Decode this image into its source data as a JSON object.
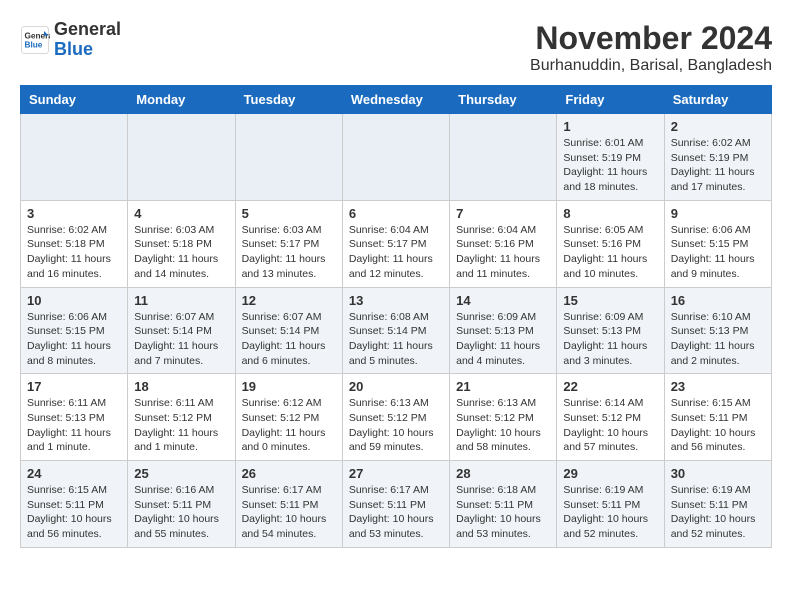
{
  "logo": {
    "line1": "General",
    "line2": "Blue"
  },
  "title": "November 2024",
  "subtitle": "Burhanuddin, Barisal, Bangladesh",
  "days_of_week": [
    "Sunday",
    "Monday",
    "Tuesday",
    "Wednesday",
    "Thursday",
    "Friday",
    "Saturday"
  ],
  "weeks": [
    [
      {
        "day": "",
        "info": ""
      },
      {
        "day": "",
        "info": ""
      },
      {
        "day": "",
        "info": ""
      },
      {
        "day": "",
        "info": ""
      },
      {
        "day": "",
        "info": ""
      },
      {
        "day": "1",
        "info": "Sunrise: 6:01 AM\nSunset: 5:19 PM\nDaylight: 11 hours and 18 minutes."
      },
      {
        "day": "2",
        "info": "Sunrise: 6:02 AM\nSunset: 5:19 PM\nDaylight: 11 hours and 17 minutes."
      }
    ],
    [
      {
        "day": "3",
        "info": "Sunrise: 6:02 AM\nSunset: 5:18 PM\nDaylight: 11 hours and 16 minutes."
      },
      {
        "day": "4",
        "info": "Sunrise: 6:03 AM\nSunset: 5:18 PM\nDaylight: 11 hours and 14 minutes."
      },
      {
        "day": "5",
        "info": "Sunrise: 6:03 AM\nSunset: 5:17 PM\nDaylight: 11 hours and 13 minutes."
      },
      {
        "day": "6",
        "info": "Sunrise: 6:04 AM\nSunset: 5:17 PM\nDaylight: 11 hours and 12 minutes."
      },
      {
        "day": "7",
        "info": "Sunrise: 6:04 AM\nSunset: 5:16 PM\nDaylight: 11 hours and 11 minutes."
      },
      {
        "day": "8",
        "info": "Sunrise: 6:05 AM\nSunset: 5:16 PM\nDaylight: 11 hours and 10 minutes."
      },
      {
        "day": "9",
        "info": "Sunrise: 6:06 AM\nSunset: 5:15 PM\nDaylight: 11 hours and 9 minutes."
      }
    ],
    [
      {
        "day": "10",
        "info": "Sunrise: 6:06 AM\nSunset: 5:15 PM\nDaylight: 11 hours and 8 minutes."
      },
      {
        "day": "11",
        "info": "Sunrise: 6:07 AM\nSunset: 5:14 PM\nDaylight: 11 hours and 7 minutes."
      },
      {
        "day": "12",
        "info": "Sunrise: 6:07 AM\nSunset: 5:14 PM\nDaylight: 11 hours and 6 minutes."
      },
      {
        "day": "13",
        "info": "Sunrise: 6:08 AM\nSunset: 5:14 PM\nDaylight: 11 hours and 5 minutes."
      },
      {
        "day": "14",
        "info": "Sunrise: 6:09 AM\nSunset: 5:13 PM\nDaylight: 11 hours and 4 minutes."
      },
      {
        "day": "15",
        "info": "Sunrise: 6:09 AM\nSunset: 5:13 PM\nDaylight: 11 hours and 3 minutes."
      },
      {
        "day": "16",
        "info": "Sunrise: 6:10 AM\nSunset: 5:13 PM\nDaylight: 11 hours and 2 minutes."
      }
    ],
    [
      {
        "day": "17",
        "info": "Sunrise: 6:11 AM\nSunset: 5:13 PM\nDaylight: 11 hours and 1 minute."
      },
      {
        "day": "18",
        "info": "Sunrise: 6:11 AM\nSunset: 5:12 PM\nDaylight: 11 hours and 1 minute."
      },
      {
        "day": "19",
        "info": "Sunrise: 6:12 AM\nSunset: 5:12 PM\nDaylight: 11 hours and 0 minutes."
      },
      {
        "day": "20",
        "info": "Sunrise: 6:13 AM\nSunset: 5:12 PM\nDaylight: 10 hours and 59 minutes."
      },
      {
        "day": "21",
        "info": "Sunrise: 6:13 AM\nSunset: 5:12 PM\nDaylight: 10 hours and 58 minutes."
      },
      {
        "day": "22",
        "info": "Sunrise: 6:14 AM\nSunset: 5:12 PM\nDaylight: 10 hours and 57 minutes."
      },
      {
        "day": "23",
        "info": "Sunrise: 6:15 AM\nSunset: 5:11 PM\nDaylight: 10 hours and 56 minutes."
      }
    ],
    [
      {
        "day": "24",
        "info": "Sunrise: 6:15 AM\nSunset: 5:11 PM\nDaylight: 10 hours and 56 minutes."
      },
      {
        "day": "25",
        "info": "Sunrise: 6:16 AM\nSunset: 5:11 PM\nDaylight: 10 hours and 55 minutes."
      },
      {
        "day": "26",
        "info": "Sunrise: 6:17 AM\nSunset: 5:11 PM\nDaylight: 10 hours and 54 minutes."
      },
      {
        "day": "27",
        "info": "Sunrise: 6:17 AM\nSunset: 5:11 PM\nDaylight: 10 hours and 53 minutes."
      },
      {
        "day": "28",
        "info": "Sunrise: 6:18 AM\nSunset: 5:11 PM\nDaylight: 10 hours and 53 minutes."
      },
      {
        "day": "29",
        "info": "Sunrise: 6:19 AM\nSunset: 5:11 PM\nDaylight: 10 hours and 52 minutes."
      },
      {
        "day": "30",
        "info": "Sunrise: 6:19 AM\nSunset: 5:11 PM\nDaylight: 10 hours and 52 minutes."
      }
    ]
  ]
}
